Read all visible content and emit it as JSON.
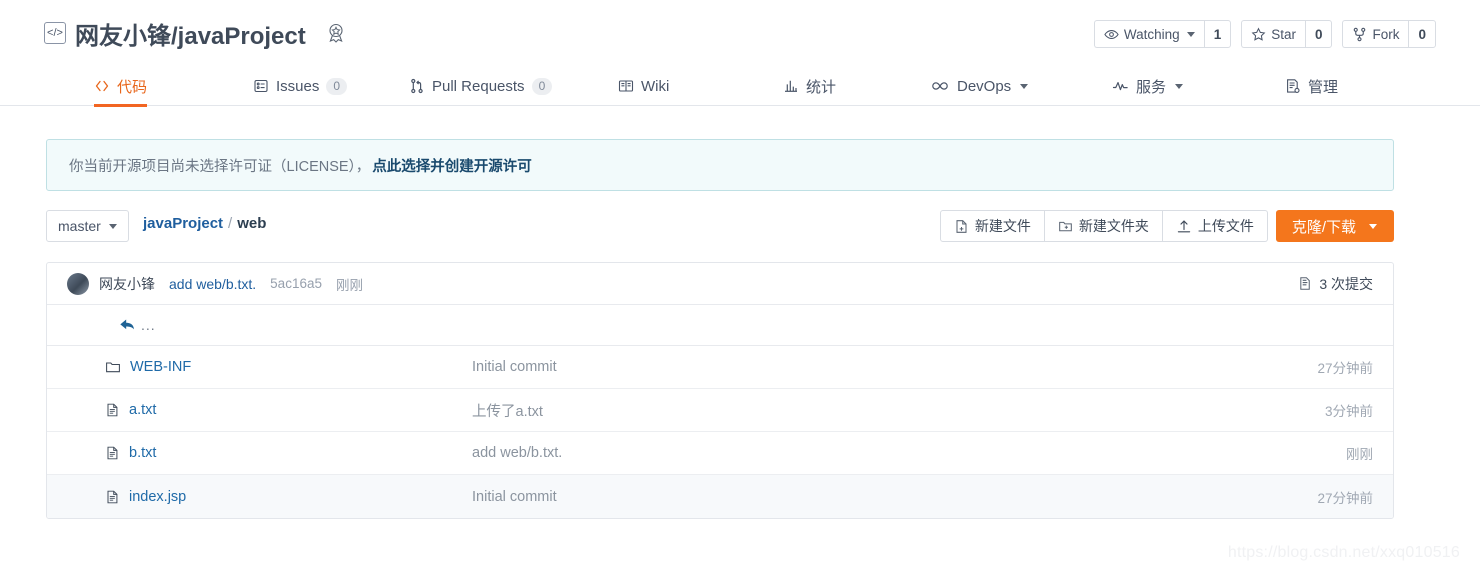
{
  "header": {
    "owner": "网友小锋",
    "separator": "/",
    "repo": "javaProject",
    "code_icon": "code-brackets-icon",
    "award_icon": "award-badge-icon",
    "actions": [
      {
        "icon": "eye-icon",
        "label": "Watching",
        "count": "1",
        "has_caret": true
      },
      {
        "icon": "star-icon",
        "label": "Star",
        "count": "0",
        "has_caret": false
      },
      {
        "icon": "fork-icon",
        "label": "Fork",
        "count": "0",
        "has_caret": false
      }
    ]
  },
  "nav": {
    "tabs": [
      {
        "label": "代码",
        "icon": "code-icon",
        "badge": null,
        "active": true,
        "caret": false
      },
      {
        "label": "Issues",
        "icon": "issues-icon",
        "badge": "0",
        "active": false,
        "caret": false
      },
      {
        "label": "Pull Requests",
        "icon": "pull-request-icon",
        "badge": "0",
        "active": false,
        "caret": false
      },
      {
        "label": "Wiki",
        "icon": "book-icon",
        "badge": null,
        "active": false,
        "caret": false
      },
      {
        "label": "统计",
        "icon": "bar-chart-icon",
        "badge": null,
        "active": false,
        "caret": false
      },
      {
        "label": "DevOps",
        "icon": "infinity-icon",
        "badge": null,
        "active": false,
        "caret": true
      },
      {
        "label": "服务",
        "icon": "pulse-icon",
        "badge": null,
        "active": false,
        "caret": true
      },
      {
        "label": "管理",
        "icon": "settings-doc-icon",
        "badge": null,
        "active": false,
        "caret": false
      }
    ]
  },
  "license_banner": {
    "text": "你当前开源项目尚未选择许可证（LICENSE），",
    "link": "点此选择并创建开源许可"
  },
  "toolbar": {
    "branch": "master",
    "breadcrumb_repo": "javaProject",
    "breadcrumb_sep": "/",
    "breadcrumb_current": "web",
    "new_file": "新建文件",
    "new_folder": "新建文件夹",
    "upload_file": "上传文件",
    "clone_download": "克隆/下载"
  },
  "commit_bar": {
    "author": "网友小锋",
    "message": "add web/b.txt.",
    "sha": "5ac16a5",
    "time": "刚刚",
    "commits_count": "3 次提交"
  },
  "file_list": {
    "parent_dir": "...",
    "rows": [
      {
        "name": "WEB-INF",
        "type": "folder",
        "message": "Initial commit",
        "time": "27分钟前"
      },
      {
        "name": "a.txt",
        "type": "file",
        "message": "上传了a.txt",
        "time": "3分钟前"
      },
      {
        "name": "b.txt",
        "type": "file",
        "message": "add web/b.txt.",
        "time": "刚刚"
      },
      {
        "name": "index.jsp",
        "type": "file",
        "message": "Initial commit",
        "time": "27分钟前"
      }
    ]
  },
  "watermark": "https://blog.csdn.net/xxq010516",
  "colors": {
    "accent_orange": "#f4761c",
    "link_blue": "#1f6aa8",
    "banner_bg": "#f2fafb",
    "banner_border": "#bfe0e4",
    "muted_text": "#8b949f"
  }
}
